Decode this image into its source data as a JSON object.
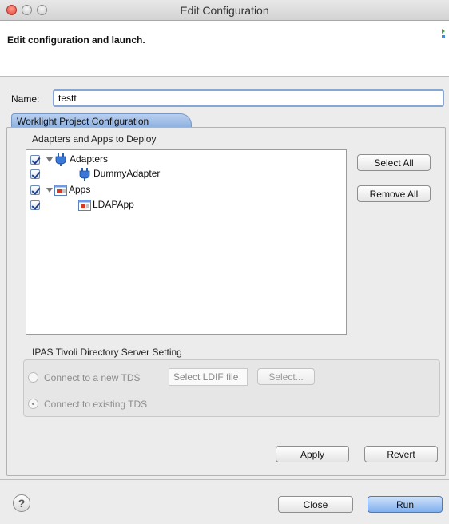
{
  "window": {
    "title": "Edit Configuration"
  },
  "header": {
    "title": "Edit configuration and launch."
  },
  "name_field": {
    "label": "Name:",
    "value": "testt"
  },
  "tabs": [
    {
      "label": "Worklight Project Configuration"
    }
  ],
  "adapters_group": {
    "title": "Adapters and Apps to Deploy",
    "tree": [
      {
        "label": "Adapters",
        "checked": true,
        "expanded": true,
        "icon": "adapter-plug-icon"
      },
      {
        "label": "DummyAdapter",
        "checked": true,
        "icon": "adapter-plug-icon"
      },
      {
        "label": "Apps",
        "checked": true,
        "expanded": true,
        "icon": "app-window-icon"
      },
      {
        "label": "LDAPApp",
        "checked": true,
        "icon": "app-window-icon"
      }
    ],
    "select_all_label": "Select All",
    "remove_all_label": "Remove All"
  },
  "tds_group": {
    "title": "IPAS Tivoli Directory Server Setting",
    "new_tds_label": "Connect to a new TDS",
    "ldif_placeholder": "Select LDIF file",
    "select_button_label": "Select...",
    "existing_tds_label": "Connect to existing TDS",
    "selected": "existing"
  },
  "actions": {
    "apply_label": "Apply",
    "revert_label": "Revert"
  },
  "footer": {
    "help_symbol": "?",
    "close_label": "Close",
    "run_label": "Run"
  },
  "colors": {
    "tab_blue": "#8db0e0",
    "run_button": "#7fb0ee",
    "checkmark": "#1a3d8a"
  }
}
